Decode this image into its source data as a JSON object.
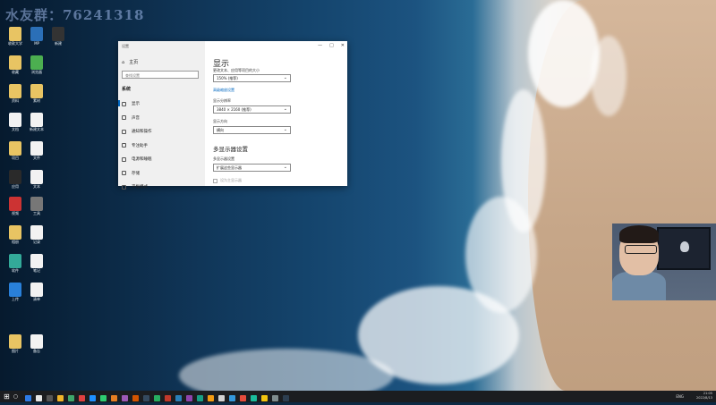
{
  "watermark": "水友群：76241318",
  "desktop_icons": [
    {
      "name": "folder",
      "color": "#e8c463",
      "label": "收款大学"
    },
    {
      "name": "mp",
      "color": "#2b6fb7",
      "label": "MP"
    },
    {
      "name": "app",
      "color": "#333",
      "label": "新建"
    },
    {
      "name": "folder",
      "color": "#e8c463",
      "label": "收藏"
    },
    {
      "name": "chrome",
      "color": "#4caf50",
      "label": "浏览器"
    },
    {
      "name": "folder",
      "color": "#e8c463",
      "label": "资料"
    },
    {
      "name": "folder",
      "color": "#e8c463",
      "label": "素材"
    },
    {
      "name": "doc",
      "color": "#f2f2f2",
      "label": "文档"
    },
    {
      "name": "doc",
      "color": "#f2f2f2",
      "label": "新建文本"
    },
    {
      "name": "folder",
      "color": "#e8c463",
      "label": "项目"
    },
    {
      "name": "doc",
      "color": "#f2f2f2",
      "label": "文件"
    },
    {
      "name": "app",
      "color": "#2a2a2a",
      "label": "应用"
    },
    {
      "name": "doc",
      "color": "#f2f2f2",
      "label": "文本"
    },
    {
      "name": "app",
      "color": "#c33",
      "label": "视频"
    },
    {
      "name": "app",
      "color": "#777",
      "label": "工具"
    },
    {
      "name": "folder",
      "color": "#e8c463",
      "label": "相册"
    },
    {
      "name": "doc",
      "color": "#f2f2f2",
      "label": "记录"
    },
    {
      "name": "app",
      "color": "#3a9",
      "label": "软件"
    },
    {
      "name": "doc",
      "color": "#f2f2f2",
      "label": "笔记"
    },
    {
      "name": "app",
      "color": "#2980d9",
      "label": "上传"
    },
    {
      "name": "doc",
      "color": "#f2f2f2",
      "label": "清单"
    },
    {
      "name": "folder",
      "color": "#e8c463",
      "label": "图片"
    },
    {
      "name": "doc",
      "color": "#f2f2f2",
      "label": "备忘"
    }
  ],
  "settings": {
    "window_title": "设置",
    "home": "主页",
    "search_placeholder": "查找设置",
    "group": "系统",
    "nav": [
      {
        "icon": "monitor-icon",
        "label": "显示",
        "selected": true
      },
      {
        "icon": "speaker-icon",
        "label": "声音",
        "selected": false
      },
      {
        "icon": "notification-icon",
        "label": "通知和操作",
        "selected": false
      },
      {
        "icon": "moon-icon",
        "label": "专注助手",
        "selected": false
      },
      {
        "icon": "power-icon",
        "label": "电源和睡眠",
        "selected": false
      },
      {
        "icon": "storage-icon",
        "label": "存储",
        "selected": false
      },
      {
        "icon": "tablet-icon",
        "label": "平板模式",
        "selected": false
      }
    ],
    "main": {
      "heading": "显示",
      "scale_label": "更改文本、应用等项目的大小",
      "scale_value": "150% (推荐)",
      "advanced_link": "高级缩放设置",
      "resolution_label": "显示分辨率",
      "resolution_value": "3840 × 2160 (推荐)",
      "orientation_label": "显示方向",
      "orientation_value": "横向",
      "multi_heading": "多显示器设置",
      "multi_label": "多显示器设置",
      "multi_value": "扩展这些显示器",
      "main_display_checkbox": "设为主显示器"
    }
  },
  "taskbar": {
    "icons": [
      "#2d7be6",
      "#e6e6e6",
      "#555",
      "#f0b429",
      "#3ea66b",
      "#e04040",
      "#1e90ff",
      "#2ecc71",
      "#e67e22",
      "#9b59b6",
      "#d35400",
      "#34495e",
      "#27ae60",
      "#c0392b",
      "#2980b9",
      "#8e44ad",
      "#16a085",
      "#f39c12",
      "#d2d2d2",
      "#3498db",
      "#e74c3c",
      "#1abc9c",
      "#f1c40f",
      "#7f8c8d",
      "#2c3e50"
    ],
    "lang": "ENG",
    "time": "21:05",
    "date": "2022/8/13"
  }
}
